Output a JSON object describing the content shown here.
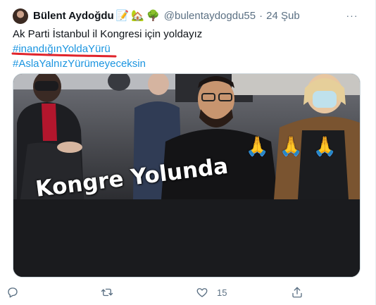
{
  "tweet": {
    "author": {
      "display_name": "Bülent Aydoğdu",
      "emojis": [
        "📝",
        "🏡",
        "🌳"
      ],
      "handle": "@bulentaydogdu55",
      "separator": "·",
      "date": "24 Şub"
    },
    "more_icon": "more-dots-icon",
    "more_label": "···",
    "text": {
      "line1": "Ak Parti İstanbul il Kongresi için yoldayız",
      "hashtag1": "#inandığınYoldaYürü",
      "hashtag2": "#AslaYalnızYürümeyeceksin"
    },
    "annotation_color": "#e0242b",
    "media": {
      "overlay_text": "Kongre Yolunda",
      "emoji": "🙏"
    },
    "actions": {
      "reply": {
        "icon": "reply-icon",
        "count": ""
      },
      "retweet": {
        "icon": "retweet-icon",
        "count": ""
      },
      "like": {
        "icon": "heart-icon",
        "count": "15"
      },
      "share": {
        "icon": "share-icon",
        "count": ""
      }
    },
    "colors": {
      "link": "#1b95e0",
      "muted": "#5b7083",
      "text": "#0f1419"
    }
  }
}
